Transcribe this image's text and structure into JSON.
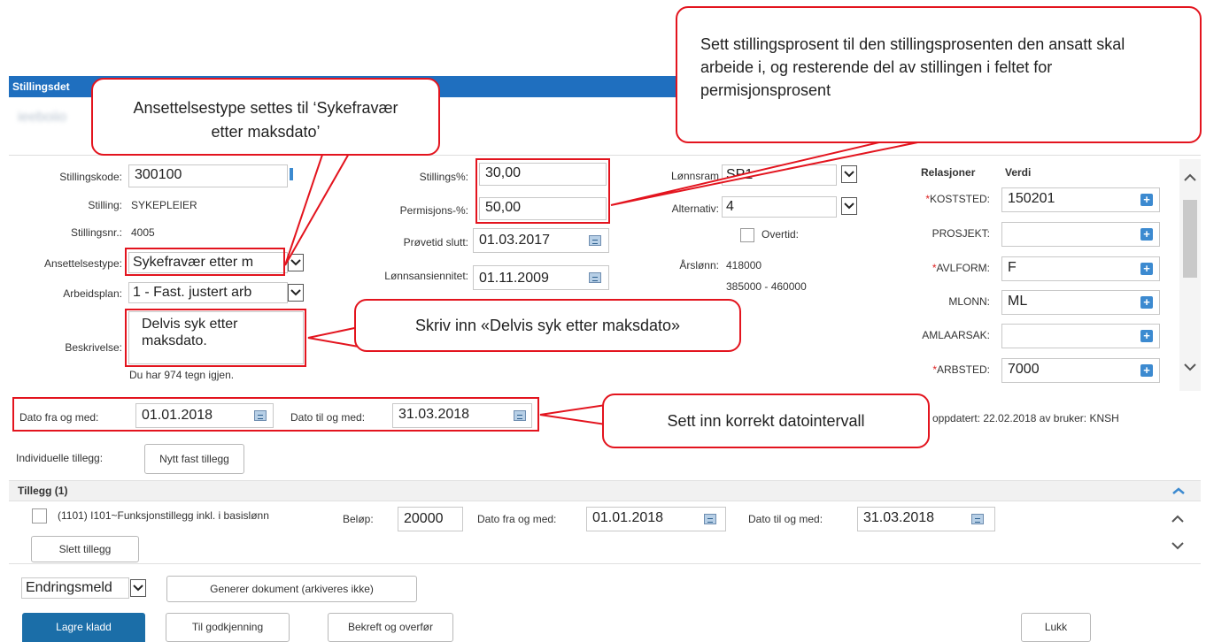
{
  "header": {
    "title": "Stillingsdet",
    "blurred_name": "ieeboiio"
  },
  "left": {
    "stillingskode_label": "Stillingskode:",
    "stillingskode_value": "300100",
    "stilling_label": "Stilling:",
    "stilling_value": "SYKEPLEIER",
    "stillingsnr_label": "Stillingsnr.:",
    "stillingsnr_value": "4005",
    "ansettelsestype_label": "Ansettelsestype:",
    "ansettelsestype_value": "Sykefravær etter m",
    "arbeidsplan_label": "Arbeidsplan:",
    "arbeidsplan_value": "1 - Fast. justert arb",
    "beskrivelse_label": "Beskrivelse:",
    "beskrivelse_value": "Delvis syk etter maksdato.",
    "chars_left": "Du har 974 tegn igjen."
  },
  "middle": {
    "stillings_label": "Stillings%:",
    "stillings_value": "30,00",
    "permisjons_label": "Permisjons-%:",
    "permisjons_value": "50,00",
    "provetid_label": "Prøvetid slutt:",
    "provetid_value": "01.03.2017",
    "lonnsans_label": "Lønnsansiennitet:",
    "lonnsans_value": "01.11.2009"
  },
  "right": {
    "lonnsramme_label": "Lønnsram",
    "lonnsramme_value": "SP1",
    "alternativ_label": "Alternativ:",
    "alternativ_value": "4",
    "overtid_label": "Overtid:",
    "arslonn_label": "Årslønn:",
    "arslonn_value": "418000",
    "arslonn_range": "385000 - 460000"
  },
  "relations": {
    "header_rel": "Relasjoner",
    "header_verdi": "Verdi",
    "rows": [
      {
        "star": "*",
        "label": "KOSTSTED:",
        "value": "150201"
      },
      {
        "star": "",
        "label": "PROSJEKT:",
        "value": ""
      },
      {
        "star": "*",
        "label": "AVLFORM:",
        "value": "F"
      },
      {
        "star": "",
        "label": "MLONN:",
        "value": "ML"
      },
      {
        "star": "",
        "label": "AMLAARSAK:",
        "value": ""
      },
      {
        "star": "*",
        "label": "ARBSTED:",
        "value": "7000"
      }
    ]
  },
  "dates": {
    "fra_label": "Dato fra og med:",
    "fra_value": "01.01.2018",
    "til_label": "Dato til og med:",
    "til_value": "31.03.2018",
    "updated": "oppdatert: 22.02.2018 av bruker: KNSH"
  },
  "tillegg": {
    "individuelle_label": "Individuelle tillegg:",
    "nytt_button": "Nytt fast tillegg",
    "section_title": "Tillegg (1)",
    "item_label": "(1101) I101~Funksjonstillegg inkl. i basislønn",
    "belop_label": "Beløp:",
    "belop_value": "20000",
    "fra_label": "Dato fra og med:",
    "fra_value": "01.01.2018",
    "til_label": "Dato til og med:",
    "til_value": "31.03.2018",
    "slett_button": "Slett tillegg"
  },
  "footer": {
    "endring_value": "Endringsmeld",
    "generer_button": "Generer dokument (arkiveres ikke)",
    "lagre_button": "Lagre kladd",
    "godkjenning_button": "Til godkjenning",
    "bekreft_button": "Bekreft og overfør",
    "lukk_button": "Lukk"
  },
  "callouts": {
    "stillingsprosent": "Sett stillingsprosent til den stillingsprosenten den ansatt skal arbeide i, og resterende del av stillingen i feltet for permisjonsprosent",
    "ansettelsestype": "Ansettelsestype settes til ‘Sykefravær etter maksdato’",
    "beskrivelse": "Skriv inn «Delvis syk etter maksdato»",
    "datointervall": "Sett inn korrekt datointervall"
  },
  "colors": {
    "header_bg": "#1f6fbf",
    "highlight": "#e3141e",
    "primary_button": "#1b6ea8",
    "plus": "#3c8ad0"
  }
}
